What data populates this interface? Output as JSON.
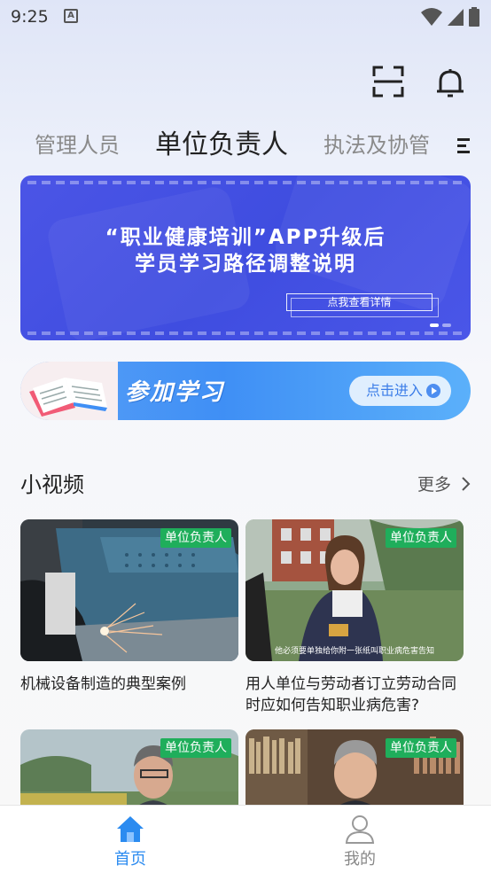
{
  "status_bar": {
    "time": "9:25",
    "notification_glyph": "A"
  },
  "tabs": [
    {
      "label": "管理人员",
      "active": false
    },
    {
      "label": "单位负责人",
      "active": true
    },
    {
      "label": "执法及协管",
      "active": false
    }
  ],
  "banner": {
    "title_line1": "“职业健康培训”APP升级后",
    "title_line2": "学员学习路径调整说明",
    "button": "点我查看详情",
    "page_count": 2,
    "current_page": 1
  },
  "study_card": {
    "label": "参加学习",
    "button": "点击进入"
  },
  "videos_section": {
    "title": "小视频",
    "more": "更多"
  },
  "videos": [
    {
      "title": "机械设备制造的典型案例",
      "tag": "单位负责人",
      "subtitle": ""
    },
    {
      "title": "用人单位与劳动者订立劳动合同时应如何告知职业病危害?",
      "tag": "单位负责人",
      "subtitle": "他必须要单独给你附一张纸叫职业病危害告知"
    },
    {
      "title": "",
      "tag": "单位负责人",
      "subtitle": ""
    },
    {
      "title": "",
      "tag": "单位负责人",
      "subtitle": ""
    }
  ],
  "bottom_nav": {
    "home": "首页",
    "mine": "我的"
  },
  "colors": {
    "accent": "#2b8bf0",
    "tag_green": "#1fae5b",
    "banner_blue": "#4350e2"
  }
}
